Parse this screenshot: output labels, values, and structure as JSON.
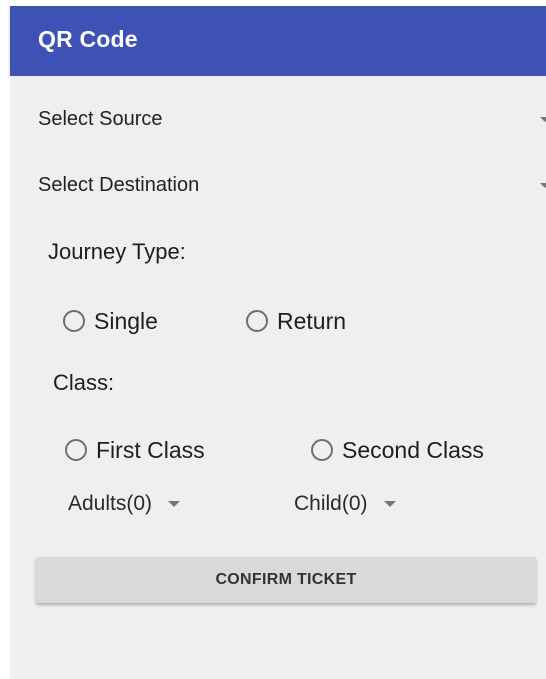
{
  "app_bar": {
    "title": "QR Code",
    "color": "#3e52b6"
  },
  "source_spinner": {
    "selected": "Select Source"
  },
  "destination_spinner": {
    "selected": "Select Destination"
  },
  "journey_type": {
    "label": "Journey Type:",
    "options": [
      "Single",
      "Return"
    ]
  },
  "travel_class": {
    "label": "Class:",
    "options": [
      "First Class",
      "Second Class"
    ]
  },
  "adults_spinner": {
    "selected": "Adults(0)"
  },
  "child_spinner": {
    "selected": "Child(0)"
  },
  "confirm_button": {
    "label": "CONFIRM TICKET"
  },
  "icons": {
    "radio": "radio-unchecked-icon",
    "dropdown": "dropdown-arrow-icon"
  }
}
